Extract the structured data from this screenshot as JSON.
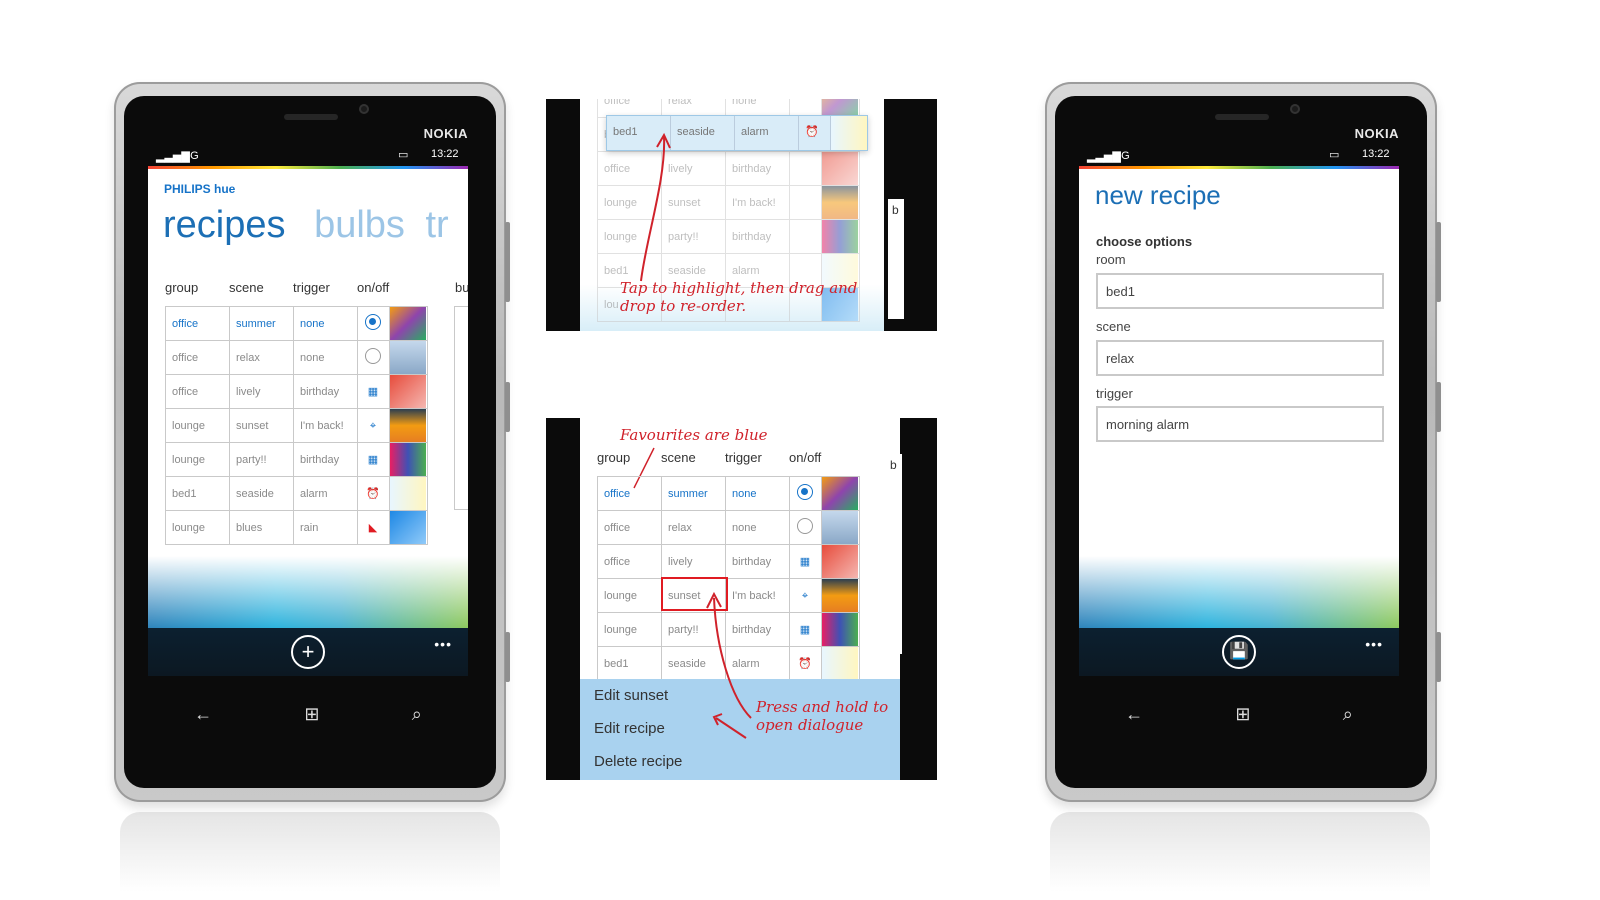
{
  "statusbar": {
    "network": "4G",
    "time": "13:22"
  },
  "brand": "NOKIA",
  "left": {
    "app_name": "PHILIPS hue",
    "pivots": [
      "recipes",
      "bulbs",
      "tr"
    ],
    "columns": [
      "group",
      "scene",
      "trigger",
      "on/off"
    ],
    "peek_column": "bu",
    "rows": [
      {
        "group": "office",
        "scene": "summer",
        "trigger": "none",
        "control": "radio-on-icon",
        "fav": true
      },
      {
        "group": "office",
        "scene": "relax",
        "trigger": "none",
        "control": "radio-off-icon",
        "fav": false
      },
      {
        "group": "office",
        "scene": "lively",
        "trigger": "birthday",
        "control": "calendar-icon",
        "fav": false
      },
      {
        "group": "lounge",
        "scene": "sunset",
        "trigger": "I'm back!",
        "control": "location-pin-icon",
        "fav": false
      },
      {
        "group": "lounge",
        "scene": "party!!",
        "trigger": "birthday",
        "control": "calendar-icon",
        "fav": false
      },
      {
        "group": "bed1",
        "scene": "seaside",
        "trigger": "alarm",
        "control": "alarm-clock-icon",
        "fav": false
      },
      {
        "group": "lounge",
        "scene": "blues",
        "trigger": "rain",
        "control": "weather-icon",
        "fav": false
      }
    ],
    "appbar_button": "add-icon"
  },
  "middle_top": {
    "rows": [
      {
        "group": "office",
        "scene": "relax",
        "trigger": "none"
      },
      {
        "group": "bed1",
        "scene": "seaside",
        "trigger": "alarm"
      },
      {
        "group": "office",
        "scene": "lively",
        "trigger": "birthday"
      },
      {
        "group": "lounge",
        "scene": "sunset",
        "trigger": "I'm back!"
      },
      {
        "group": "lounge",
        "scene": "party!!",
        "trigger": "birthday"
      },
      {
        "group": "bed1",
        "scene": "seaside",
        "trigger": "alarm"
      },
      {
        "group": "lou",
        "scene": "",
        "trigger": ""
      }
    ],
    "peek": "b",
    "note": "Tap to highlight, then drag and drop to re-order."
  },
  "middle_bottom": {
    "note_fav": "Favourites are blue",
    "columns": [
      "group",
      "scene",
      "trigger",
      "on/off"
    ],
    "rows": [
      {
        "group": "office",
        "scene": "summer",
        "trigger": "none"
      },
      {
        "group": "office",
        "scene": "relax",
        "trigger": "none"
      },
      {
        "group": "office",
        "scene": "lively",
        "trigger": "birthday"
      },
      {
        "group": "lounge",
        "scene": "sunset",
        "trigger": "I'm back!"
      },
      {
        "group": "lounge",
        "scene": "party!!",
        "trigger": "birthday"
      },
      {
        "group": "bed1",
        "scene": "seaside",
        "trigger": "alarm"
      }
    ],
    "peek": "b",
    "menu": [
      "Edit sunset",
      "Edit recipe",
      "Delete recipe"
    ],
    "note_press": "Press and hold to open dialogue"
  },
  "right": {
    "title": "new recipe",
    "section": "choose options",
    "room_label": "room",
    "room_value": "bed1",
    "scene_label": "scene",
    "scene_value": "relax",
    "trigger_label": "trigger",
    "trigger_value": "morning alarm",
    "appbar_button": "save-icon"
  },
  "colors": {
    "accent": "#1673c8",
    "annotation": "#d0222b",
    "menu_bg": "#a9d2ef"
  }
}
